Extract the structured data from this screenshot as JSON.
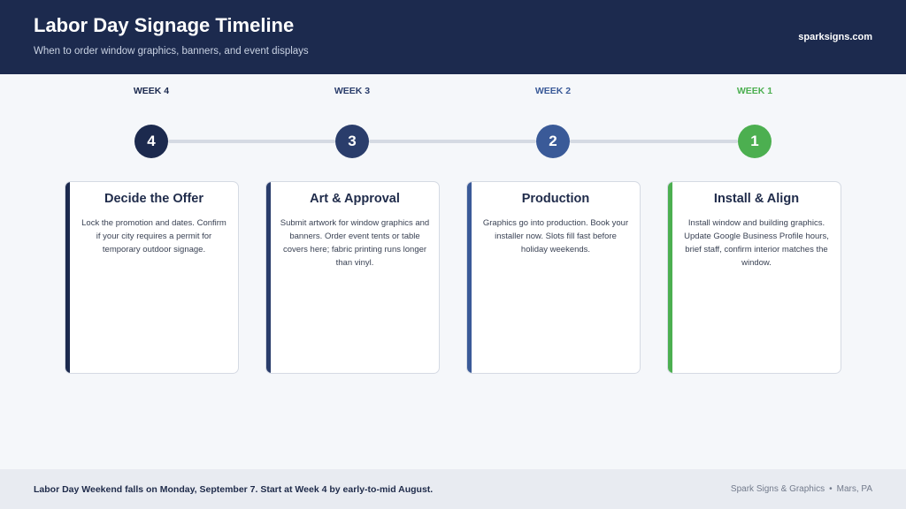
{
  "header": {
    "title": "Labor Day Signage Timeline",
    "subtitle": "When to order window graphics, banners, and event displays",
    "site": "sparksigns.com"
  },
  "steps": [
    {
      "week": "WEEK 4",
      "number": "4",
      "color": "#1c2a4e",
      "title": "Decide the Offer",
      "body": "Lock the promotion and dates. Confirm if your city requires a permit for temporary outdoor signage."
    },
    {
      "week": "WEEK 3",
      "number": "3",
      "color": "#2a3d6b",
      "title": "Art & Approval",
      "body": "Submit artwork for window graphics and banners. Order event tents or table covers here; fabric printing runs longer than vinyl."
    },
    {
      "week": "WEEK 2",
      "number": "2",
      "color": "#3a5a98",
      "title": "Production",
      "body": "Graphics go into production. Book your installer now. Slots fill fast before holiday weekends."
    },
    {
      "week": "WEEK 1",
      "number": "1",
      "color": "#4caf50",
      "title": "Install & Align",
      "body": "Install window and building graphics. Update Google Business Profile hours, brief staff, confirm interior matches the window."
    }
  ],
  "footer": {
    "note": "Labor Day Weekend falls on Monday, September 7. Start at Week 4 by early-to-mid August.",
    "company": "Spark Signs & Graphics",
    "separator": "•",
    "location": "Mars, PA"
  }
}
